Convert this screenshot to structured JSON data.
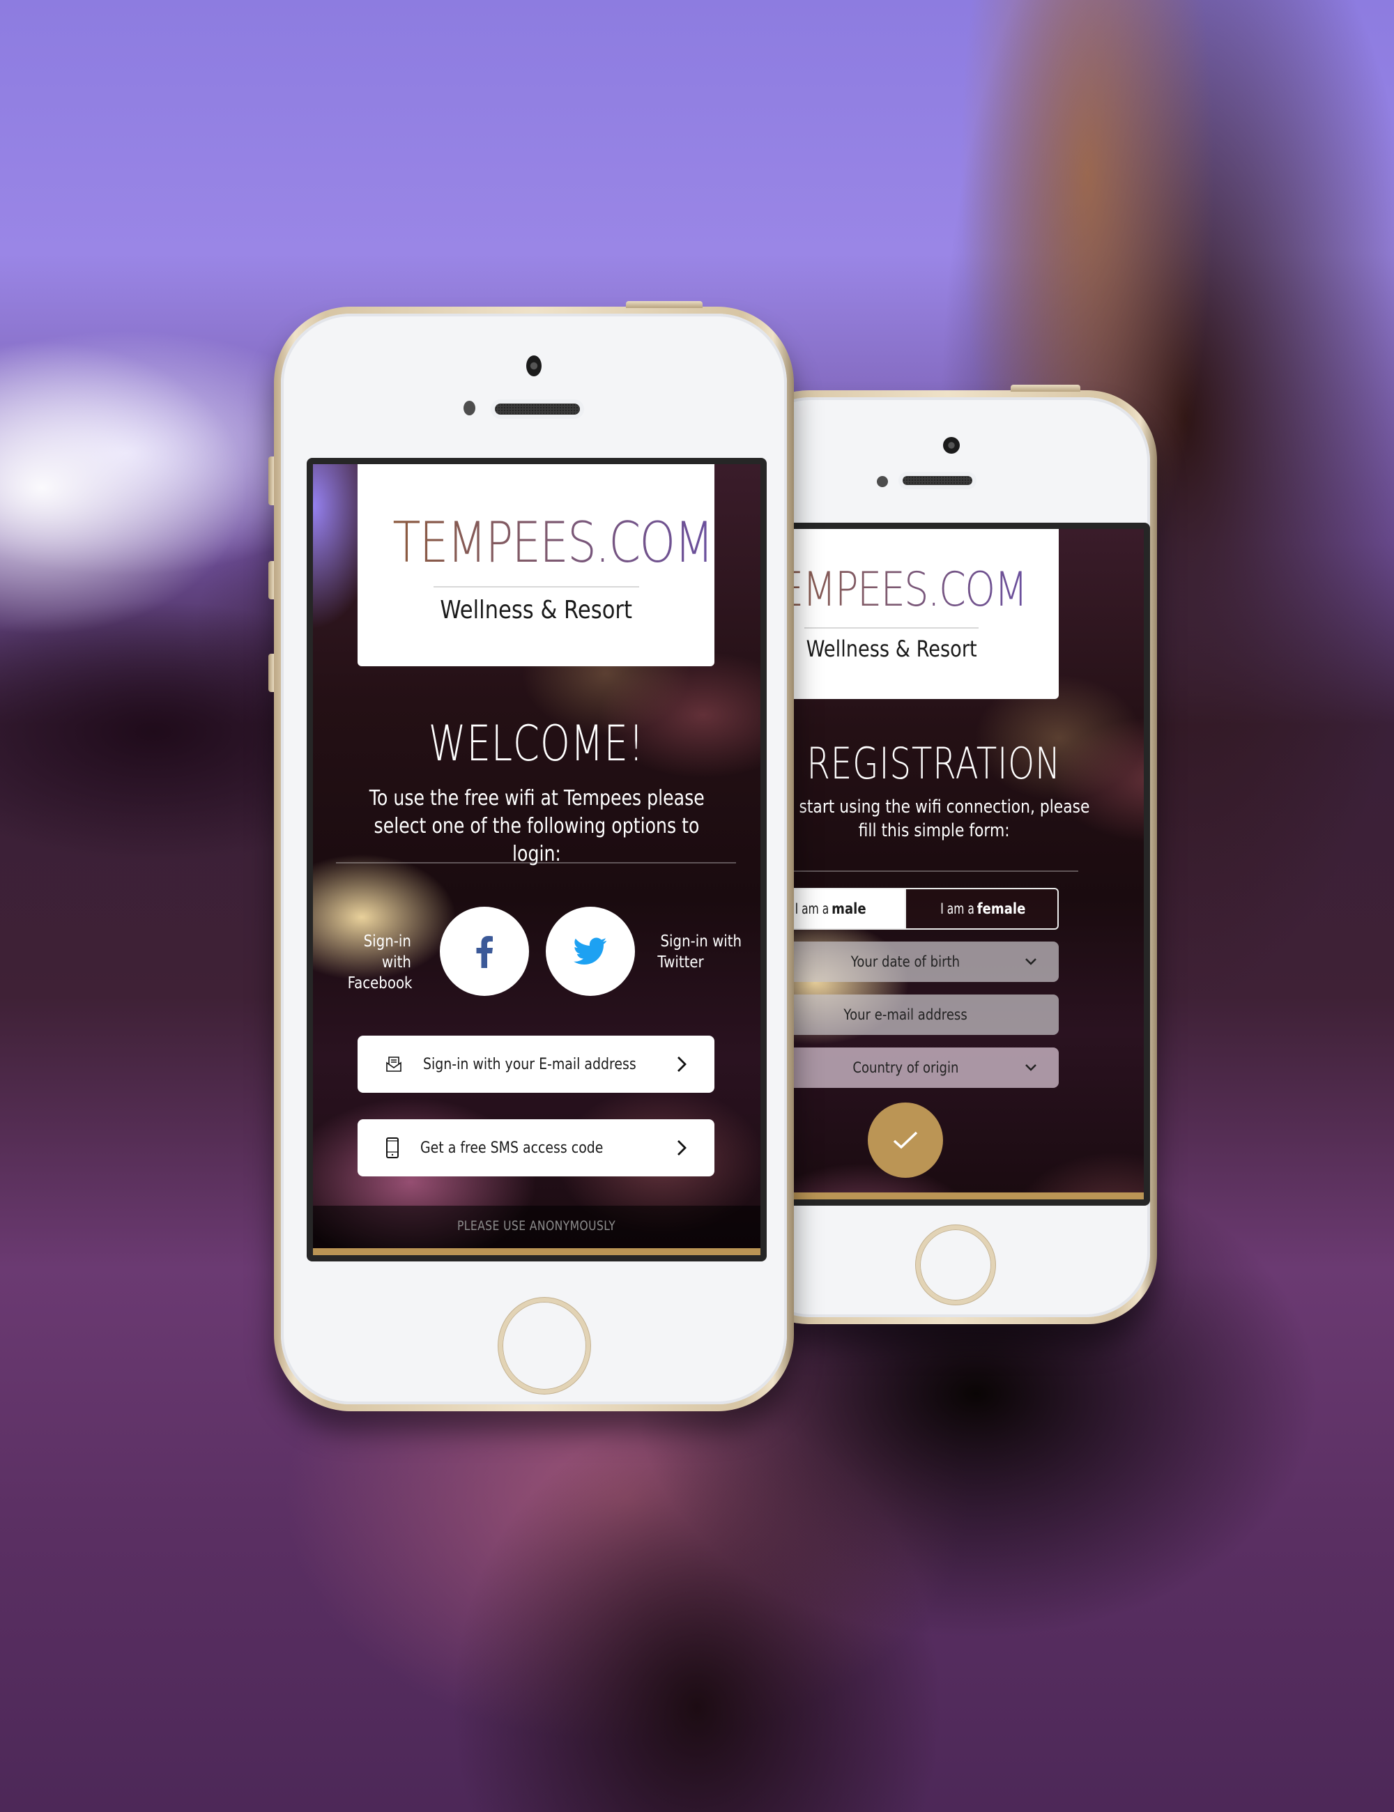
{
  "login_screen": {
    "brand": {
      "title": "TEMPEES.COM",
      "subtitle": "Wellness & Resort"
    },
    "heading": "WELCOME!",
    "intro_line1": "To use the free wifi at Tempees please",
    "intro_line2": "select one of the following options to login:",
    "facebook": {
      "label_line1": "Sign-in with",
      "label_line2": "Facebook",
      "icon": "facebook-icon",
      "color": "#3b5998"
    },
    "twitter": {
      "label_line1": "Sign-in with",
      "label_line2": "Twitter",
      "icon": "twitter-icon",
      "color": "#1da1f2"
    },
    "actions": [
      {
        "label": "Sign-in with your E-mail address",
        "icon": "envelope-icon"
      },
      {
        "label": "Get a free SMS access code",
        "icon": "mobile-phone-icon"
      }
    ],
    "footer_note": "PLEASE USE ANONYMOUSLY"
  },
  "registration_screen": {
    "brand": {
      "title": "TEMPEES.COM",
      "subtitle": "Wellness & Resort"
    },
    "heading": "REGISTRATION",
    "intro_line1": "To start using the wifi connection, please",
    "intro_line2": "fill this simple form:",
    "gender": {
      "male_prefix": "I am a ",
      "male_value": "male",
      "female_prefix": "I am a ",
      "female_value": "female",
      "selected": "male"
    },
    "fields": {
      "dob_placeholder": "Your date of birth",
      "email_placeholder": "Your e-mail address",
      "country_placeholder": "Country of origin"
    },
    "submit_icon": "checkmark-icon"
  },
  "colors": {
    "accent_gold": "#bb9555",
    "brand_start": "#8c5a3e",
    "brand_end": "#6a4f9e"
  }
}
